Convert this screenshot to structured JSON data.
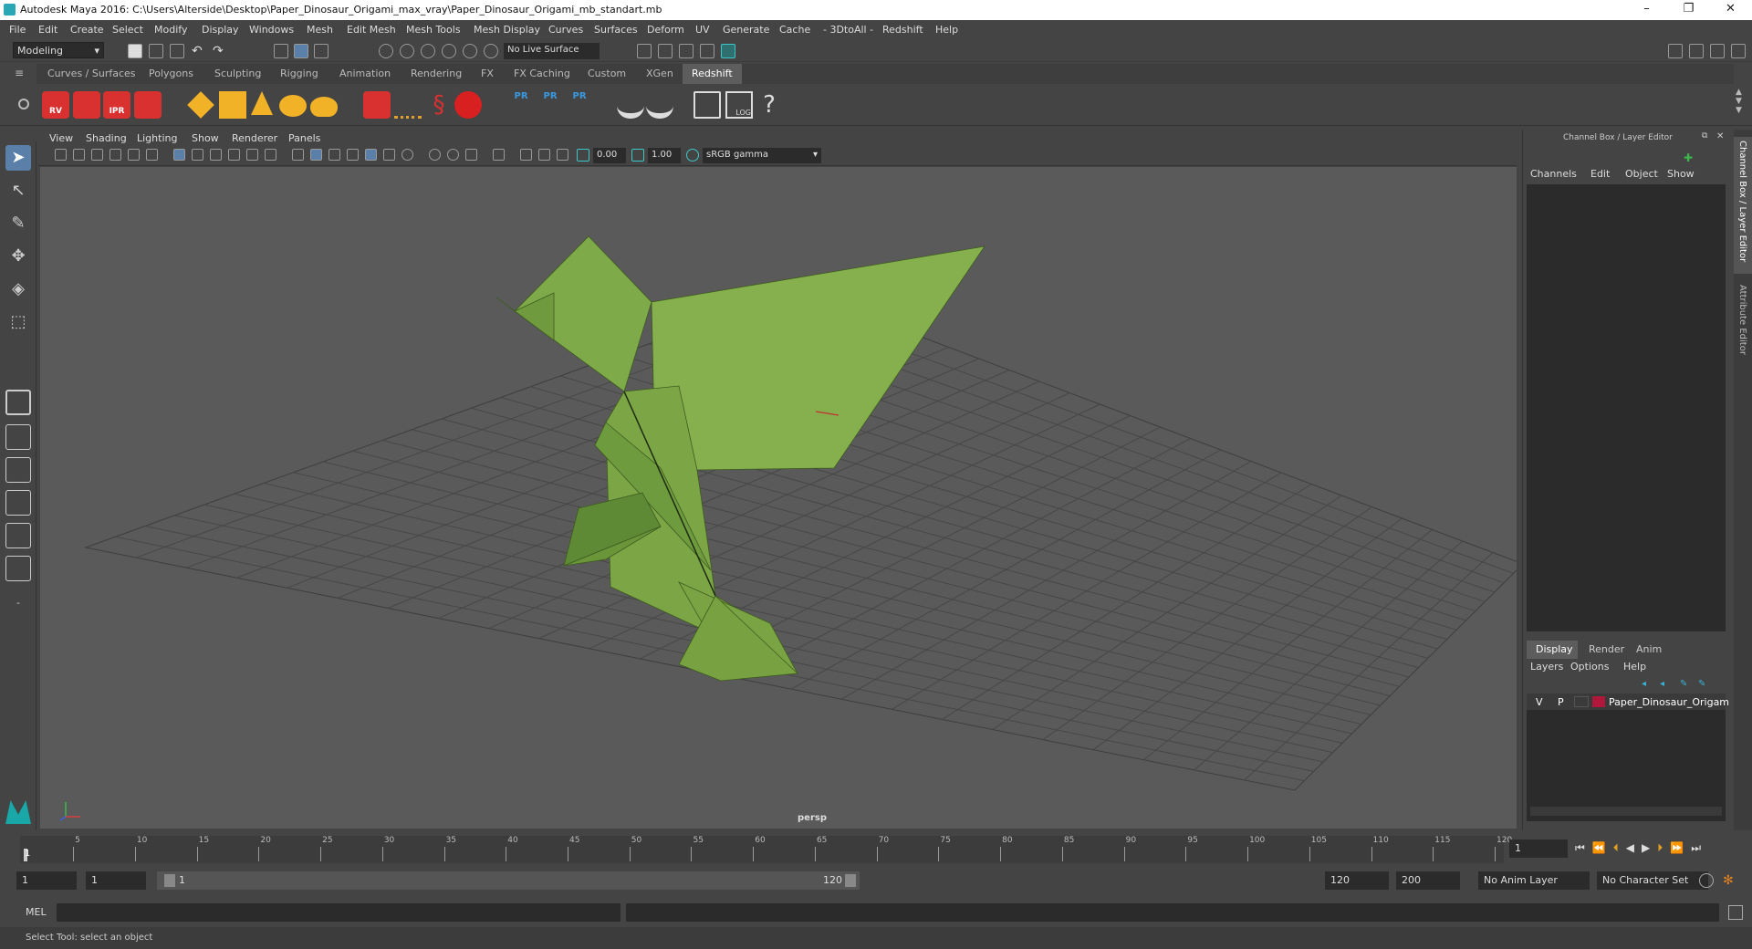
{
  "title": "Autodesk Maya 2016: C:\\Users\\Alterside\\Desktop\\Paper_Dinosaur_Origami_max_vray\\Paper_Dinosaur_Origami_mb_standart.mb",
  "window_controls": {
    "minimize": "–",
    "restore": "❐",
    "close": "✕"
  },
  "menu": [
    "File",
    "Edit",
    "Create",
    "Select",
    "Modify",
    "Display",
    "Windows",
    "Mesh",
    "Edit Mesh",
    "Mesh Tools",
    "Mesh Display",
    "Curves",
    "Surfaces",
    "Deform",
    "UV",
    "Generate",
    "Cache",
    "- 3DtoAll -",
    "Redshift",
    "Help"
  ],
  "status": {
    "mode": "Modeling",
    "live_surface": "No Live Surface"
  },
  "shelf_tabs": [
    "Curves / Surfaces",
    "Polygons",
    "Sculpting",
    "Rigging",
    "Animation",
    "Rendering",
    "FX",
    "FX Caching",
    "Custom",
    "XGen",
    "Redshift"
  ],
  "shelf_active": "Redshift",
  "shelf_icon_labels": {
    "rv": "RV",
    "ipr": "IPR",
    "pr": "PR",
    "log": "LOG",
    "help": "?"
  },
  "viewport_menu": [
    "View",
    "Shading",
    "Lighting",
    "Show",
    "Renderer",
    "Panels"
  ],
  "viewport_fields": {
    "exposure": "0.00",
    "gamma": "1.00",
    "colorspace": "sRGB gamma"
  },
  "camera": "persp",
  "right_panel": {
    "header": "Channel Box / Layer Editor",
    "menu": [
      "Channels",
      "Edit",
      "Object",
      "Show"
    ],
    "layer_tabs": [
      "Display",
      "Render",
      "Anim"
    ],
    "layer_tab_active": "Display",
    "layer_menu": [
      "Layers",
      "Options",
      "Help"
    ],
    "layer": {
      "v": "V",
      "p": "P",
      "name": "Paper_Dinosaur_Origam",
      "color": "#b0173a"
    }
  },
  "side_tabs": [
    "Channel Box / Layer Editor",
    "Attribute Editor"
  ],
  "timeline": {
    "ticks": [
      "5",
      "10",
      "15",
      "20",
      "25",
      "30",
      "35",
      "40",
      "45",
      "50",
      "55",
      "60",
      "65",
      "70",
      "75",
      "80",
      "85",
      "90",
      "95",
      "100",
      "105",
      "110",
      "115",
      "120"
    ],
    "start_marker": "1",
    "current_frame": "1"
  },
  "range": {
    "start": "1",
    "anim_start": "1",
    "slider_start": "1",
    "slider_end": "120",
    "anim_end": "120",
    "end": "200",
    "anim_layer": "No Anim Layer",
    "char_set": "No Character Set"
  },
  "cmd": {
    "label": "MEL"
  },
  "help_line": "Select Tool: select an object"
}
